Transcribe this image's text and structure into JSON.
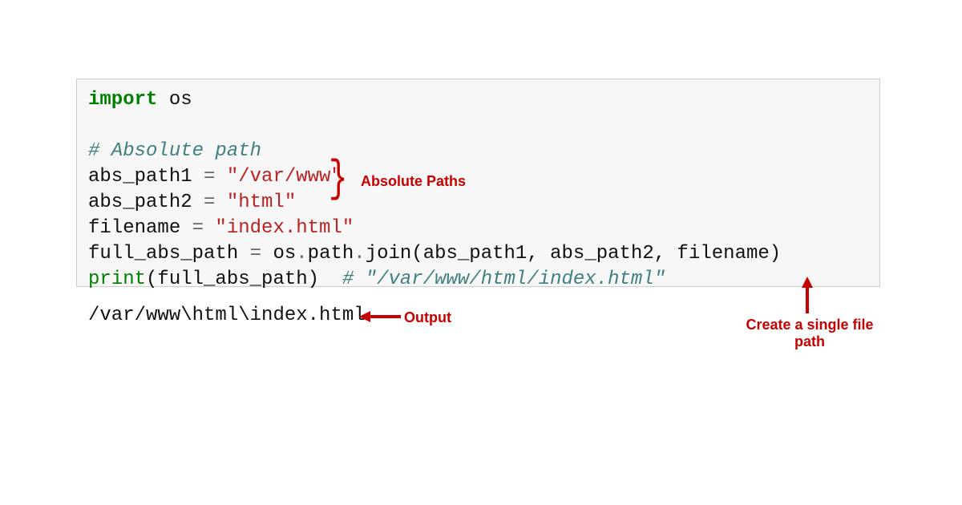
{
  "code": {
    "line1_kw": "import",
    "line1_mod": " os",
    "line3_comment": "# Absolute path",
    "line4_var": "abs_path1 ",
    "line4_op": "=",
    "line4_str": " \"/var/www\"",
    "line5_var": "abs_path2 ",
    "line5_op": "=",
    "line5_str": " \"html\"",
    "line6_var": "filename ",
    "line6_op": "=",
    "line6_str": " \"index.html\"",
    "line7_var": "full_abs_path ",
    "line7_op": "=",
    "line7_rest1": " os",
    "line7_dot1": ".",
    "line7_rest2": "path",
    "line7_dot2": ".",
    "line7_rest3": "join(abs_path1, abs_path2, filename)",
    "line8_fn": "print",
    "line8_rest": "(full_abs_path)  ",
    "line8_comment": "# \"/var/www/html/index.html\""
  },
  "output": "/var/www\\html\\index.html",
  "annotations": {
    "absolute_paths": "Absolute Paths",
    "output_label": "Output",
    "single_file_path_l1": "Create a single file",
    "single_file_path_l2": "path"
  }
}
